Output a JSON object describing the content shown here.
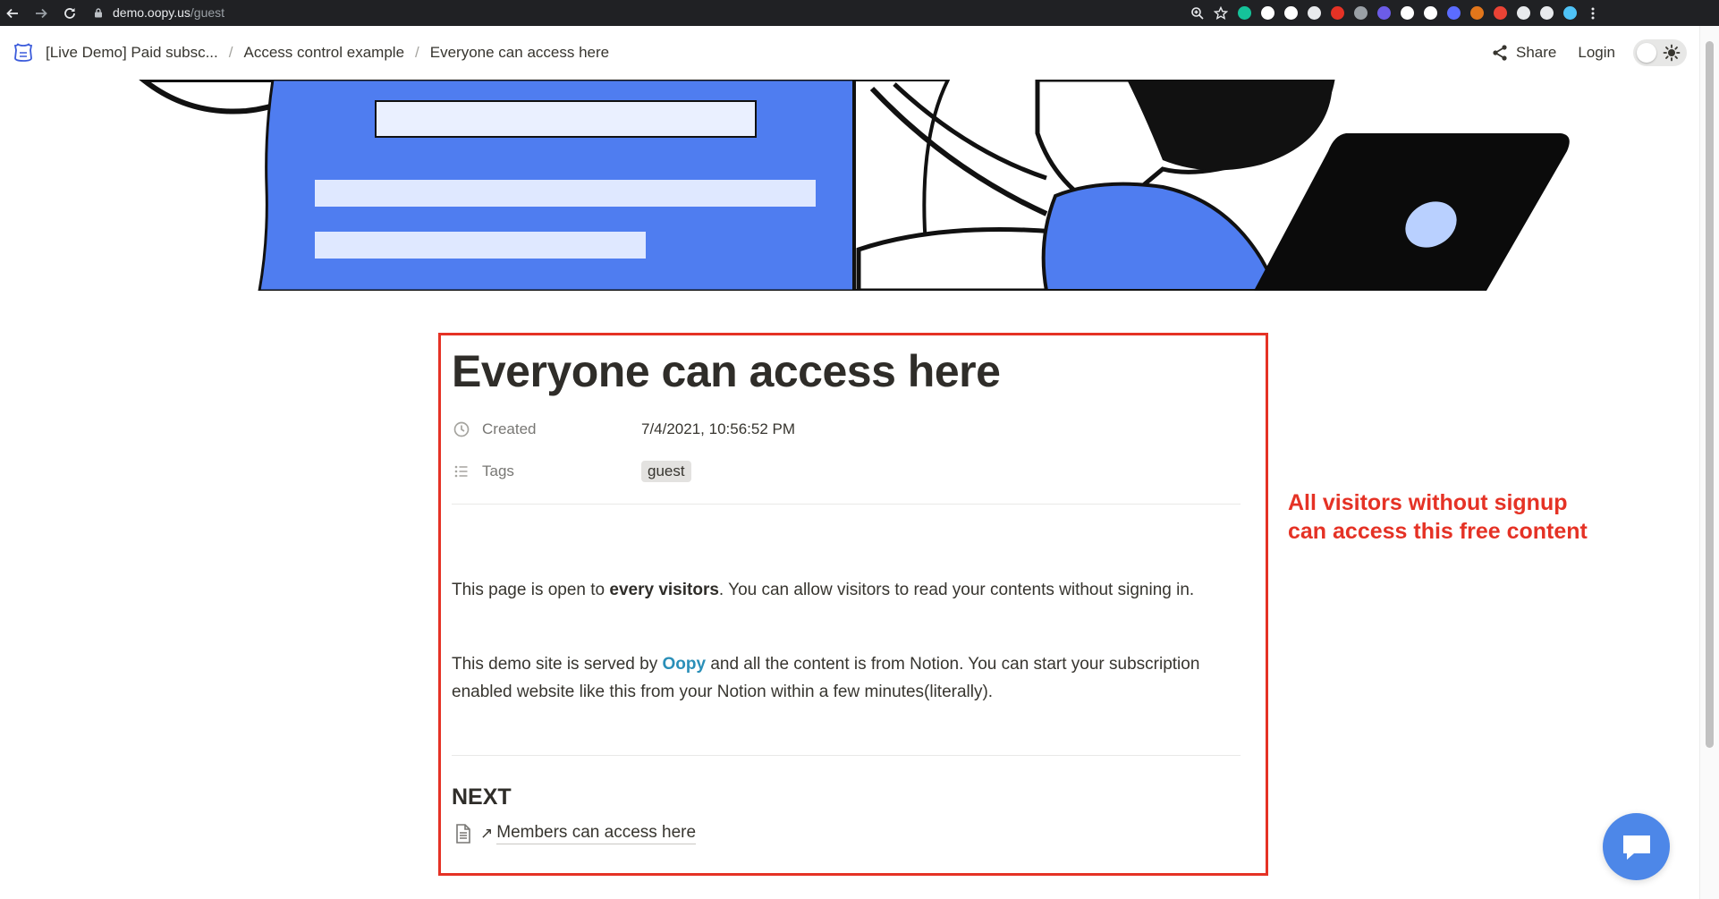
{
  "browser": {
    "url_host": "demo.oopy.us",
    "url_path": "/guest",
    "extensions": [
      {
        "name": "grammarly-icon",
        "color": "#15c39a"
      },
      {
        "name": "extension-c-icon",
        "color": "#ffffff"
      },
      {
        "name": "notion-web-clipper-icon",
        "color": "#ffffff"
      },
      {
        "name": "layers-icon",
        "color": "#e8eaed"
      },
      {
        "name": "red-shield-icon",
        "color": "#e53225"
      },
      {
        "name": "circle-grey-icon",
        "color": "#9aa0a6"
      },
      {
        "name": "purple-compass-icon",
        "color": "#6c5ce7"
      },
      {
        "name": "white-dot-icon",
        "color": "#ffffff"
      },
      {
        "name": "screen-capture-icon",
        "color": "#ffffff"
      },
      {
        "name": "blue-pill-icon",
        "color": "#5b6cff"
      },
      {
        "name": "metamask-fox-icon",
        "color": "#e2761b"
      },
      {
        "name": "color-wheel-icon",
        "color": "#ea4335"
      },
      {
        "name": "puzzle-icon",
        "color": "#e8eaed"
      },
      {
        "name": "playlist-icon",
        "color": "#e8eaed"
      },
      {
        "name": "profile-avatar-icon",
        "color": "#4fc3f7"
      }
    ]
  },
  "header": {
    "breadcrumbs": [
      "[Live Demo] Paid subsc...",
      "Access control example",
      "Everyone can access here"
    ],
    "separator": "/",
    "share_label": "Share",
    "login_label": "Login"
  },
  "page": {
    "title": "Everyone can access here",
    "properties": {
      "created_label": "Created",
      "created_value": "7/4/2021, 10:56:52 PM",
      "tags_label": "Tags",
      "tag_value": "guest"
    },
    "para1_before": "This page is open to ",
    "para1_bold": "every visitors",
    "para1_after": ". You can allow visitors to read your contents without signing in.",
    "para2_before": "This demo site is served by ",
    "para2_link": "Oopy",
    "para2_after": " and all the content is from Notion. You can start your subscription enabled website like this from your Notion within a few minutes(literally).",
    "next_heading": "NEXT",
    "next_link_arrow": "↗",
    "next_link_label": "Members can access here"
  },
  "annotation": {
    "line1": "All visitors without signup",
    "line2": "can access this free content",
    "color": "#e53225"
  },
  "colors": {
    "accent_link": "#2a8fb8",
    "cover_blue": "#4f7df0",
    "chat_button": "#4d87e8"
  }
}
